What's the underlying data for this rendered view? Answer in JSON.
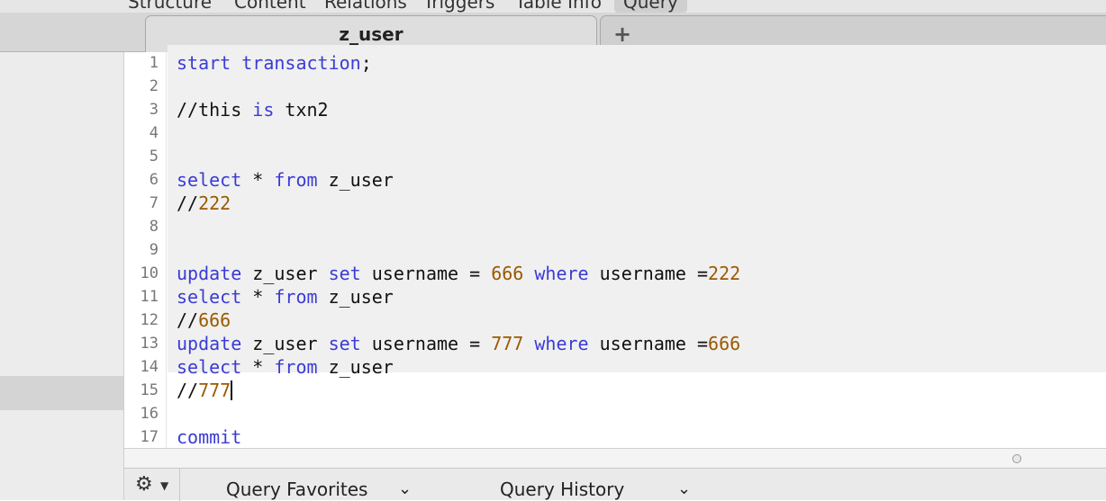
{
  "top_tabs": {
    "items": [
      "Structure",
      "Content",
      "Relations",
      "Triggers",
      "Table Info",
      "Query"
    ],
    "active": "Query"
  },
  "tab_bar": {
    "active_tab_label": "z_user",
    "add_tab_label": "+"
  },
  "editor": {
    "line_numbers": [
      "1",
      "2",
      "3",
      "4",
      "5",
      "6",
      "7",
      "8",
      "9",
      "10",
      "11",
      "12",
      "13",
      "14",
      "15",
      "16",
      "17"
    ],
    "colors": {
      "keyword": "#3b3bd6",
      "number": "#9b5a00",
      "text": "#111111"
    }
  },
  "bottom_bar": {
    "gear_icon": "gear-icon",
    "query_favorites_label": "Query Favorites",
    "query_history_label": "Query History",
    "chevron_icon": "chevron-down-icon"
  }
}
